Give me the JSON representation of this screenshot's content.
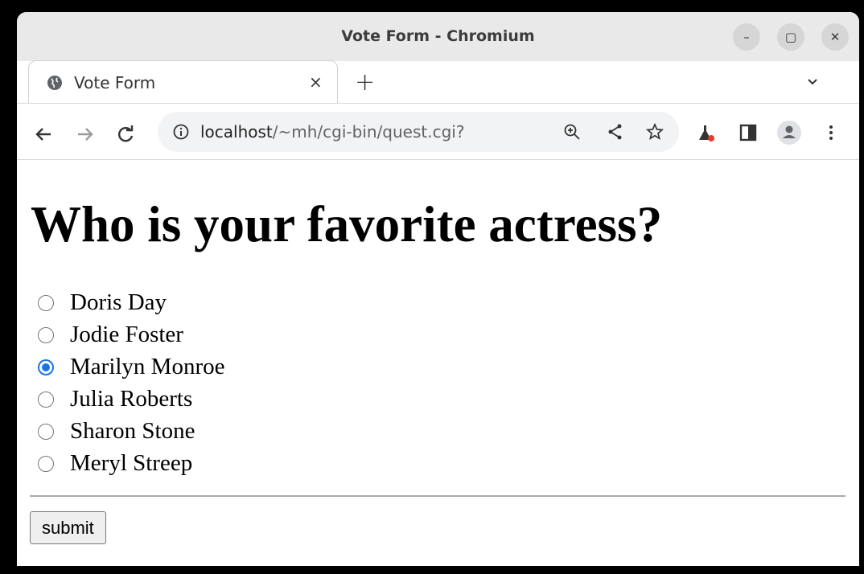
{
  "window": {
    "title": "Vote Form - Chromium"
  },
  "tab": {
    "label": "Vote Form",
    "close": "×",
    "new_tab": "+"
  },
  "toolbar": {
    "url_host": "localhost",
    "url_path": "/~mh/cgi-bin/quest.cgi?"
  },
  "page": {
    "heading": "Who is your favorite actress?",
    "options": [
      {
        "label": "Doris Day",
        "checked": false
      },
      {
        "label": "Jodie Foster",
        "checked": false
      },
      {
        "label": "Marilyn Monroe",
        "checked": true
      },
      {
        "label": "Julia Roberts",
        "checked": false
      },
      {
        "label": "Sharon Stone",
        "checked": false
      },
      {
        "label": "Meryl Streep",
        "checked": false
      }
    ],
    "submit_label": "submit"
  }
}
